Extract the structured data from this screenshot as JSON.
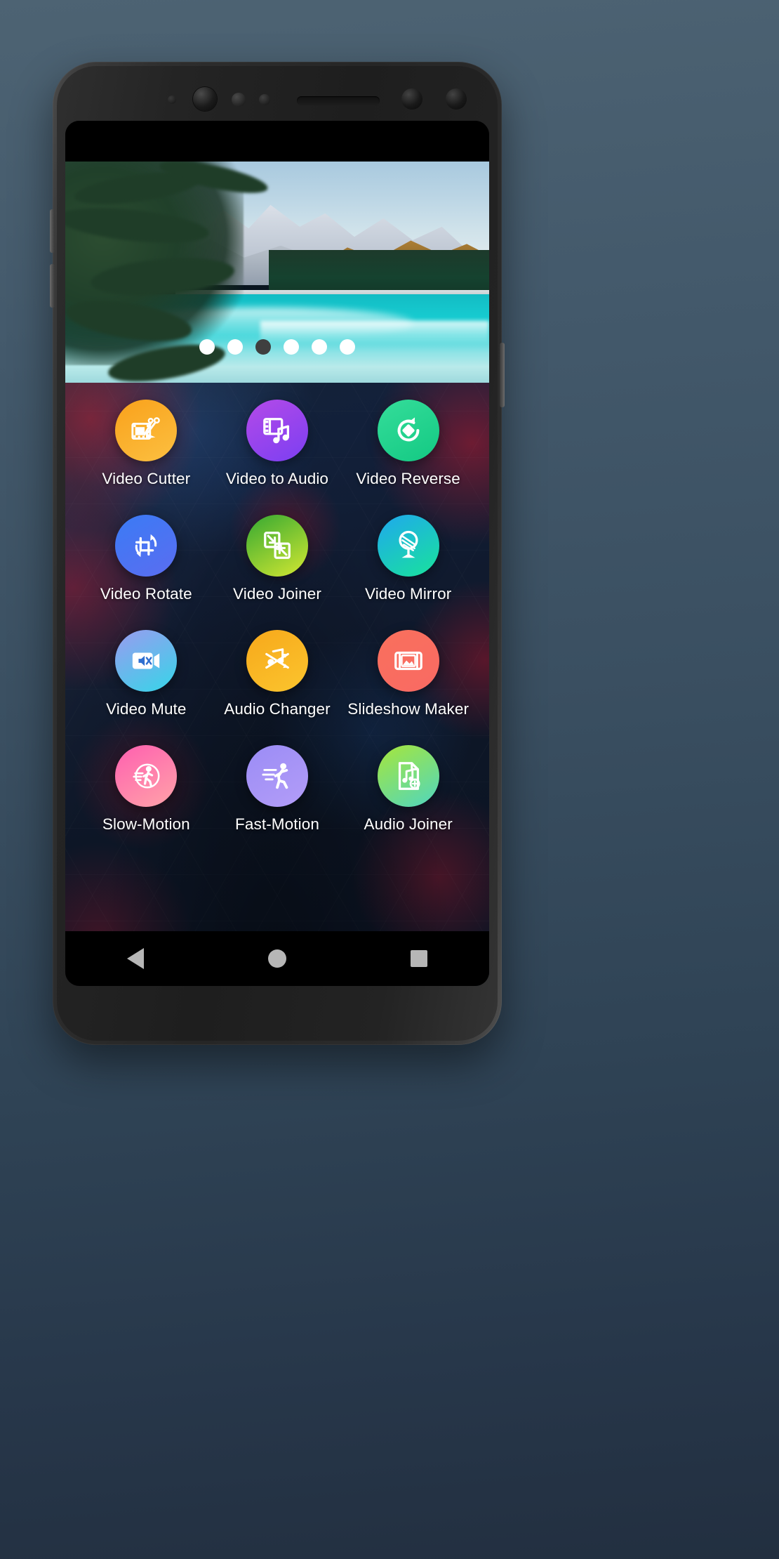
{
  "background": {
    "top_color": "#4d6373",
    "bottom_color": "#222f40"
  },
  "device": {
    "name": "android-phone-mockup",
    "hardware": {
      "sensor_dot": "sensor-dot-icon",
      "front_camera": "front-camera-icon",
      "proximity_sensor": "proximity-sensor-icon",
      "light_sensor": "light-sensor-icon",
      "earpiece_speaker": "speaker-grille-icon",
      "iris_scanner": "iris-scanner-icon",
      "secondary_camera": "secondary-camera-icon",
      "volume_up": "volume-up-button",
      "volume_down": "volume-down-button",
      "power": "power-button"
    }
  },
  "carousel": {
    "name": "promo-banner-carousel",
    "image_description": "Turquoise mountain lake with pine trees and snow-capped peaks",
    "total_dots": 6,
    "active_index": 2,
    "dot_color": "#ffffff",
    "active_dot_color": "#3f3f3f"
  },
  "app_grid": {
    "columns": 3,
    "apps": [
      {
        "label": "Video Cutter",
        "icon": "film-scissors-icon",
        "color_start": "#f9a11b",
        "color_end": "#fcc041"
      },
      {
        "label": "Video to Audio",
        "icon": "film-music-icon",
        "color_start": "#b44ae8",
        "color_end": "#7b3ff2"
      },
      {
        "label": "Video Reverse",
        "icon": "reverse-arrow-icon",
        "color_start": "#35dd9a",
        "color_end": "#13c983"
      },
      {
        "label": "Video Rotate",
        "icon": "crop-rotate-icon",
        "color_start": "#3a7bf5",
        "color_end": "#5b6df0"
      },
      {
        "label": "Video Joiner",
        "icon": "join-squares-icon",
        "color_start": "#34a832",
        "color_end": "#d4e832"
      },
      {
        "label": "Video Mirror",
        "icon": "mirror-flip-icon",
        "color_start": "#1fa8ee",
        "color_end": "#19e39b"
      },
      {
        "label": "Video Mute",
        "icon": "video-mute-icon",
        "color_start": "#9a9bf0",
        "color_end": "#35d6e8"
      },
      {
        "label": "Audio Changer",
        "icon": "audio-shuffle-icon",
        "color_start": "#f7a81b",
        "color_end": "#fbc52e"
      },
      {
        "label": "Slideshow Maker",
        "icon": "slideshow-frame-icon",
        "color_start": "#f9705d",
        "color_end": "#f96a63"
      },
      {
        "label": "Slow-Motion",
        "icon": "slow-walker-icon",
        "color_start": "#ff5fb0",
        "color_end": "#ffa3a8"
      },
      {
        "label": "Fast-Motion",
        "icon": "running-person-icon",
        "color_start": "#9b8cf5",
        "color_end": "#b39df8"
      },
      {
        "label": "Audio Joiner",
        "icon": "audio-file-add-icon",
        "color_start": "#a7e63a",
        "color_end": "#4fd6c0"
      }
    ]
  },
  "nav_bar": {
    "back": "back-triangle-icon",
    "home": "home-circle-icon",
    "recents": "recents-square-icon",
    "tint": "#b6b6b6"
  }
}
